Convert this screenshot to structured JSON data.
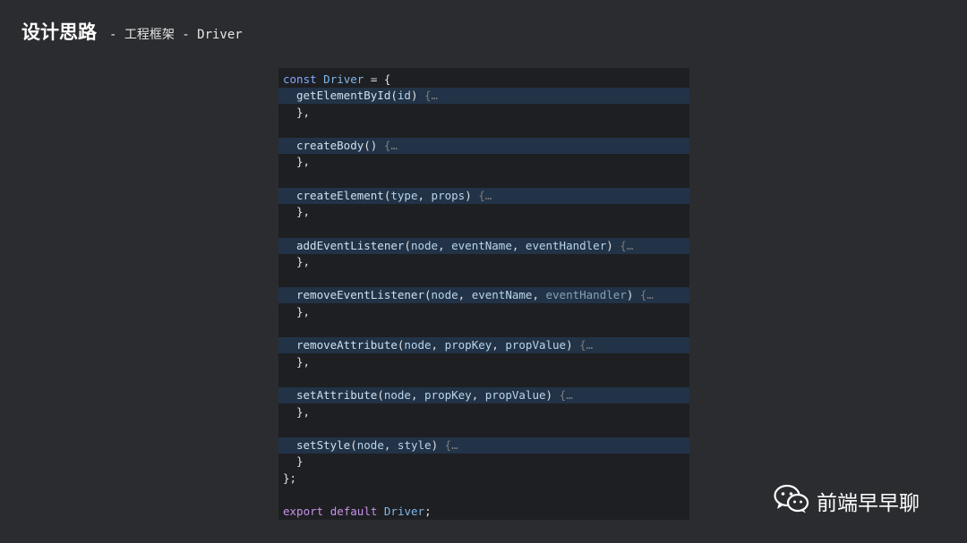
{
  "header": {
    "title": "设计思路",
    "subtitle": "- 工程框架 - Driver"
  },
  "code": {
    "decl_keyword": "const",
    "decl_name": "Driver",
    "decl_rest": " = {",
    "methods": [
      {
        "name": "getElementById",
        "params": [
          "id"
        ],
        "close": "},"
      },
      {
        "name": "createBody",
        "params": [],
        "close": "},"
      },
      {
        "name": "createElement",
        "params": [
          "type",
          "props"
        ],
        "close": "},"
      },
      {
        "name": "addEventListener",
        "params": [
          "node",
          "eventName",
          "eventHandler"
        ],
        "close": "},"
      },
      {
        "name": "removeEventListener",
        "params": [
          "node",
          "eventName",
          "eventHandler"
        ],
        "close": "},"
      },
      {
        "name": "removeAttribute",
        "params": [
          "node",
          "propKey",
          "propValue"
        ],
        "close": "},"
      },
      {
        "name": "setAttribute",
        "params": [
          "node",
          "propKey",
          "propValue"
        ],
        "close": "},"
      },
      {
        "name": "setStyle",
        "params": [
          "node",
          "style"
        ],
        "close": "}"
      }
    ],
    "fold_marker": "{…",
    "object_close": "};",
    "export_keyword": "export",
    "default_keyword": "default",
    "export_name": "Driver",
    "export_end": ";"
  },
  "brand": {
    "icon": "wechat-icon",
    "name": "前端早早聊"
  }
}
